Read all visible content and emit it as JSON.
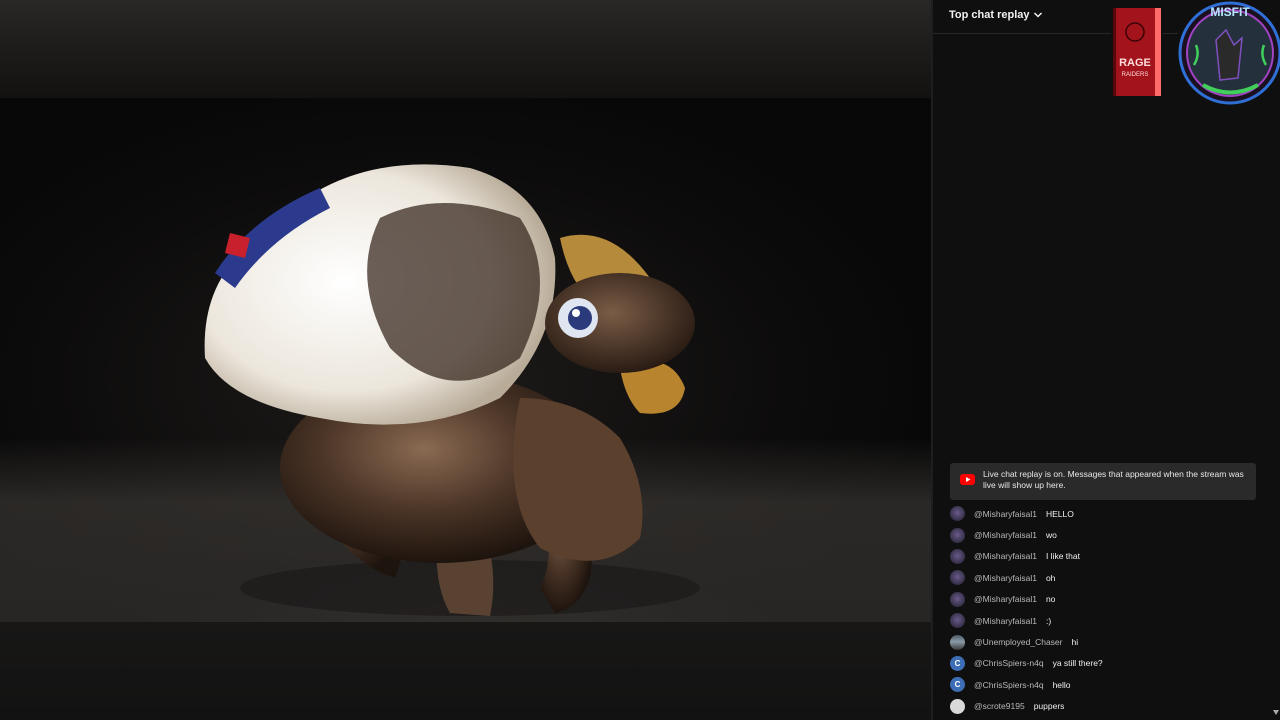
{
  "chat": {
    "header_label": "Top chat replay",
    "notice": "Live chat replay is on. Messages that appeared when the stream was live will show up here.",
    "messages": [
      {
        "author": "@Misharyfaisal1",
        "text": "HELLO",
        "avatar": "misfit"
      },
      {
        "author": "@Misharyfaisal1",
        "text": "wo",
        "avatar": "misfit"
      },
      {
        "author": "@Misharyfaisal1",
        "text": "I like that",
        "avatar": "misfit"
      },
      {
        "author": "@Misharyfaisal1",
        "text": "oh",
        "avatar": "misfit"
      },
      {
        "author": "@Misharyfaisal1",
        "text": "no",
        "avatar": "misfit"
      },
      {
        "author": "@Misharyfaisal1",
        "text": ":)",
        "avatar": "misfit"
      },
      {
        "author": "@Unemployed_Chaser",
        "text": "hi",
        "avatar": "chaser"
      },
      {
        "author": "@ChrisSpiers-n4q",
        "text": "ya still there?",
        "avatar": "letter",
        "initial": "C"
      },
      {
        "author": "@ChrisSpiers-n4q",
        "text": "hello",
        "avatar": "letter",
        "initial": "C"
      },
      {
        "author": "@scrote9195",
        "text": "puppers",
        "avatar": "scrote"
      }
    ]
  },
  "overlay": {
    "book_title_line1": "RAGE",
    "book_title_line2": "RAIDERS",
    "logo_text": "MISFIT"
  },
  "colors": {
    "accent_red": "#ff0000",
    "chat_bg": "#0f0f0f",
    "notice_bg": "#2a2a2a",
    "avatar_blue": "#3d6eb5"
  }
}
